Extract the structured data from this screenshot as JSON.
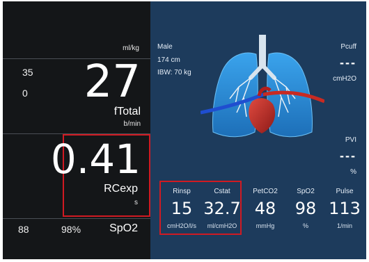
{
  "left": {
    "top_unit": "ml/kg",
    "resp_upper": "35",
    "resp_lower": "0",
    "ftotal_value": "27",
    "ftotal_label": "fTotal",
    "ftotal_unit": "b/min",
    "rcexp_value": "0.41",
    "rcexp_label": "RCexp",
    "rcexp_unit": "s",
    "spo2_upper": "88",
    "spo2_value": "98%",
    "spo2_label": "SpO2"
  },
  "patient": {
    "sex": "Male",
    "height": "174 cm",
    "ibw": "IBW: 70 kg"
  },
  "pcuff": {
    "label": "Pcuff",
    "value": "---",
    "unit": "cmH2O"
  },
  "pvi": {
    "label": "PVI",
    "value": "---",
    "unit": "%"
  },
  "params": [
    {
      "label": "Rinsp",
      "value": "15",
      "unit": "cmH2O/l/s"
    },
    {
      "label": "Cstat",
      "value": "32.7",
      "unit": "ml/cmH2O"
    },
    {
      "label": "PetCO2",
      "value": "48",
      "unit": "mmHg"
    },
    {
      "label": "SpO2",
      "value": "98",
      "unit": "%"
    },
    {
      "label": "Pulse",
      "value": "113",
      "unit": "1/min"
    }
  ],
  "colors": {
    "highlight": "#d11a22",
    "panel_left": "#141618",
    "panel_right": "#1d3b5c",
    "lung": "#2f8fd8"
  },
  "icons": {
    "lung_illustration": "lungs-heart-icon"
  }
}
